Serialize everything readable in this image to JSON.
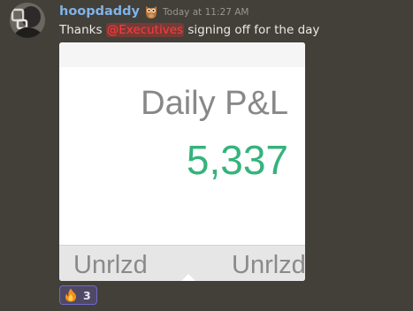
{
  "message": {
    "username": "hoopdaddy",
    "timestamp": "Today at 11:27 AM",
    "text_before": "Thanks ",
    "mention": "@Executives",
    "text_after": " signing off for the day",
    "role_badge_icon": "owl-icon",
    "colors": {
      "username": "#7fb3e6",
      "mention": "#ff3b3b",
      "background": "#433f39"
    }
  },
  "attachment": {
    "title": "Daily P&L",
    "value": "5,337",
    "value_color": "#35b37c",
    "tab_left": "Unrlzd",
    "tab_right": "Unrlzd"
  },
  "reaction": {
    "emoji_icon": "fire-icon",
    "count": "3"
  }
}
